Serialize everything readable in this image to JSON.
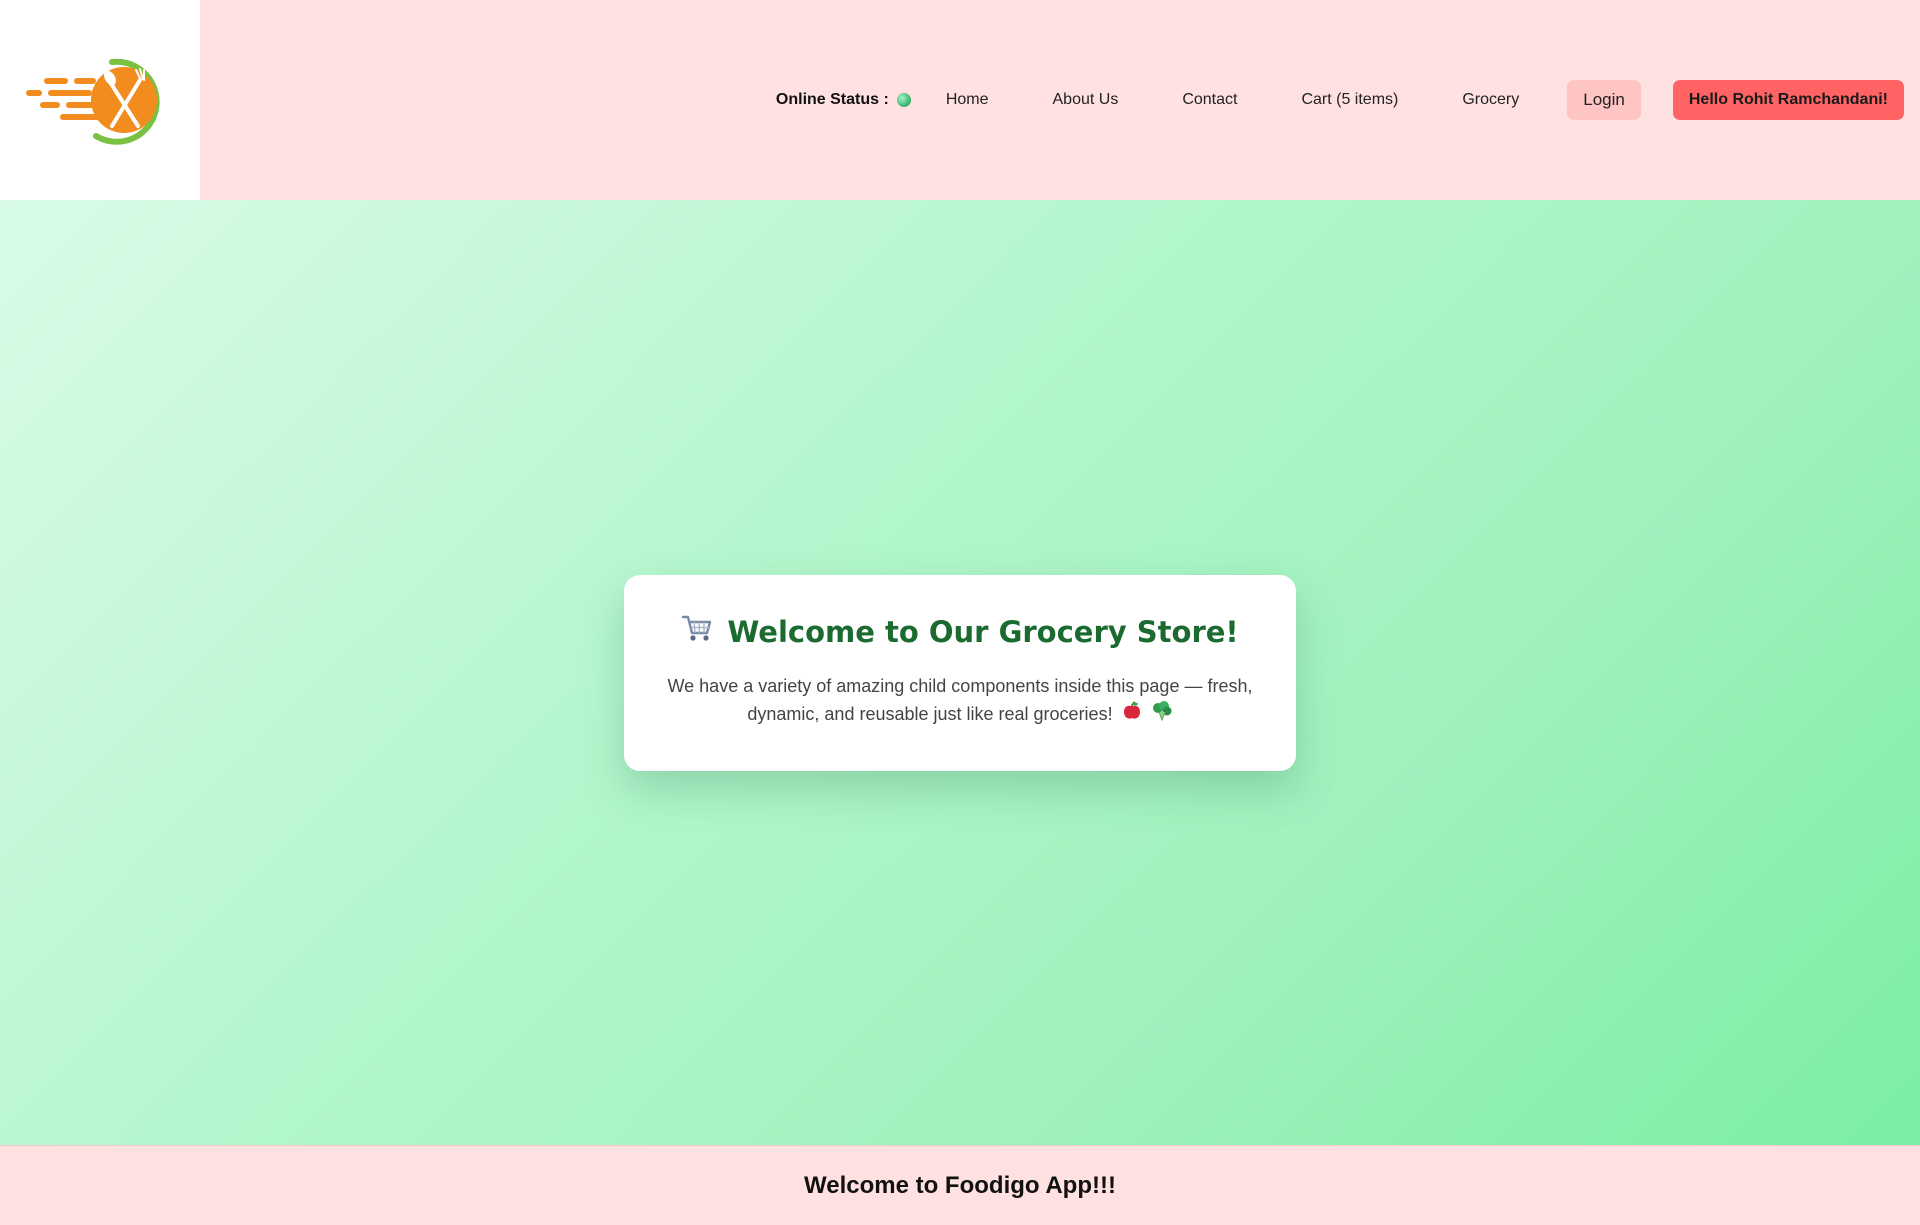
{
  "header": {
    "online_status_label": "Online Status :",
    "nav": {
      "home": "Home",
      "about": "About Us",
      "contact": "Contact",
      "cart": "Cart (5 items)",
      "grocery": "Grocery"
    },
    "login_label": "Login",
    "user_greeting": "Hello Rohit Ramchandani!"
  },
  "main": {
    "title": "Welcome to Our Grocery Store!",
    "text": "We have a variety of amazing child components inside this page — fresh, dynamic, and reusable just like real groceries!"
  },
  "footer": {
    "text": "Welcome to Foodigo App!!!"
  },
  "icons": {
    "logo": "foodigo-logo-fork-spoon",
    "status": "green-dot-icon",
    "cart": "shopping-cart-icon",
    "apple": "apple-icon",
    "broccoli": "broccoli-icon"
  },
  "colors": {
    "header_bg": "#ffe1e1",
    "title_green": "#1b6b30",
    "user_button": "#ff6363",
    "login_button": "#ffc5c5"
  }
}
